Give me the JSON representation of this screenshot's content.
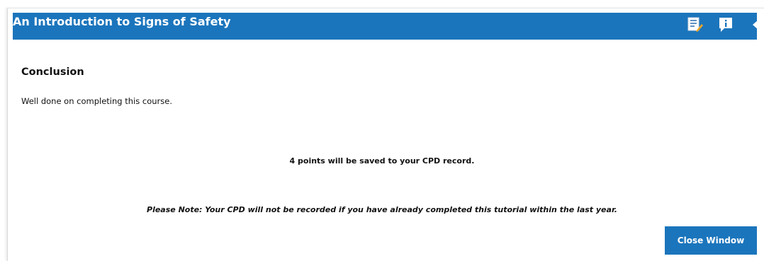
{
  "header": {
    "title": "An Introduction to Signs of Safety",
    "icons": [
      "notes-icon",
      "info-icon",
      "back-arrow-icon"
    ]
  },
  "content": {
    "heading": "Conclusion",
    "intro": "Well done on completing this course.",
    "points_message": "4 points will be saved to your CPD record.",
    "note": "Please Note: Your CPD will not be recorded if you have already completed this tutorial within the last year."
  },
  "actions": {
    "close_label": "Close Window"
  },
  "colors": {
    "brand_blue": "#1b75bc",
    "text": "#111111",
    "background": "#ffffff"
  }
}
